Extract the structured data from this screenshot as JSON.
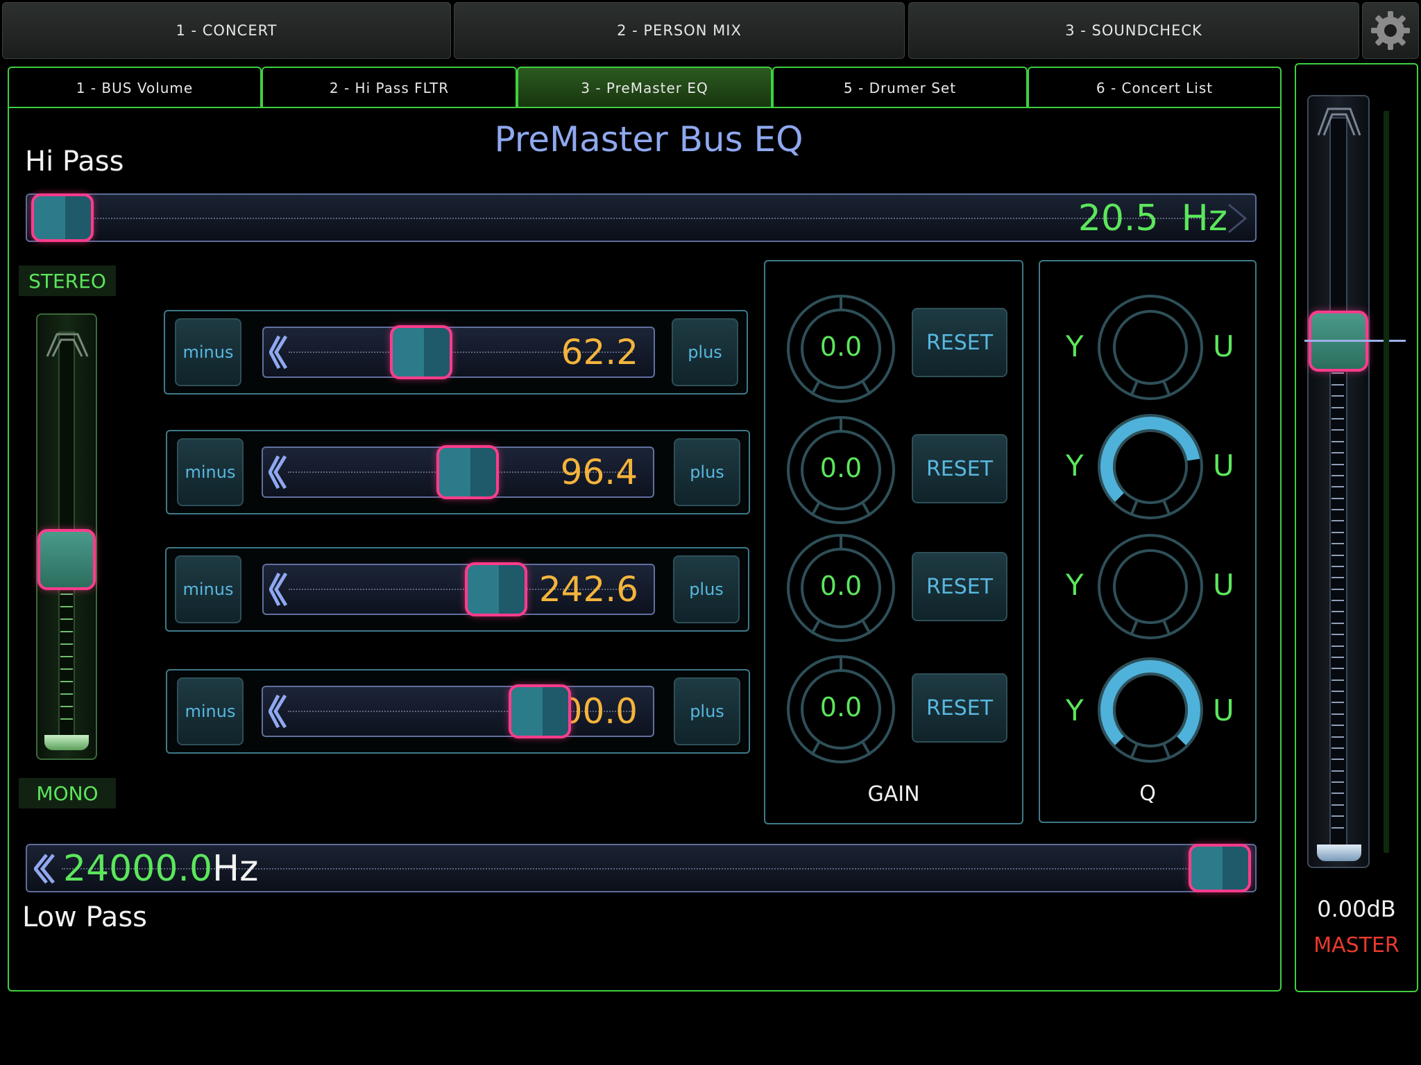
{
  "top_tabs": [
    {
      "label": "1 - CONCERT"
    },
    {
      "label": "2 - PERSON MIX"
    },
    {
      "label": "3 - SOUNDCHECK"
    }
  ],
  "sub_tabs": [
    {
      "label": "1 - BUS Volume",
      "active": false
    },
    {
      "label": "2 - Hi Pass FLTR",
      "active": false
    },
    {
      "label": "3 - PreMaster EQ",
      "active": true
    },
    {
      "label": "5 - Drumer Set",
      "active": false
    },
    {
      "label": "6 - Concert List",
      "active": false
    }
  ],
  "page": {
    "title": "PreMaster Bus EQ"
  },
  "hi_pass": {
    "label": "Hi Pass",
    "value": "20.5",
    "unit": "Hz",
    "position": 0.0
  },
  "low_pass": {
    "label": "Low Pass",
    "value": "24000.0",
    "unit": "Hz",
    "position": 1.0
  },
  "stereo_mono": {
    "top_label": "STEREO",
    "bottom_label": "MONO",
    "level": 0.45
  },
  "bands": [
    {
      "minus": "minus",
      "plus": "plus",
      "value": "62.2",
      "position": 0.38
    },
    {
      "minus": "minus",
      "plus": "plus",
      "value": "96.4",
      "position": 0.53
    },
    {
      "minus": "minus",
      "plus": "plus",
      "value": "242.6",
      "position": 0.62
    },
    {
      "minus": "minus",
      "plus": "plus",
      "value": "1800.0",
      "position": 0.76
    }
  ],
  "gain": {
    "label": "GAIN",
    "reset_label": "RESET",
    "values": [
      "0.0",
      "0.0",
      "0.0",
      "0.0"
    ]
  },
  "q": {
    "label": "Q",
    "left_label": "Y",
    "right_label": "U",
    "levels": [
      0.0,
      0.8,
      0.0,
      1.0
    ]
  },
  "master": {
    "value": "0.00dB",
    "label": "MASTER",
    "level": 0.72
  },
  "colors": {
    "accent_green": "#3fd03f",
    "value_green": "#5ce65c",
    "value_orange": "#f4b43c",
    "thumb_pink": "#ff3c8c",
    "title_blue": "#8fa8f0",
    "master_red": "#e8392e",
    "knob_blue": "#4fb2da"
  },
  "icons": {
    "settings": "gear-icon"
  }
}
